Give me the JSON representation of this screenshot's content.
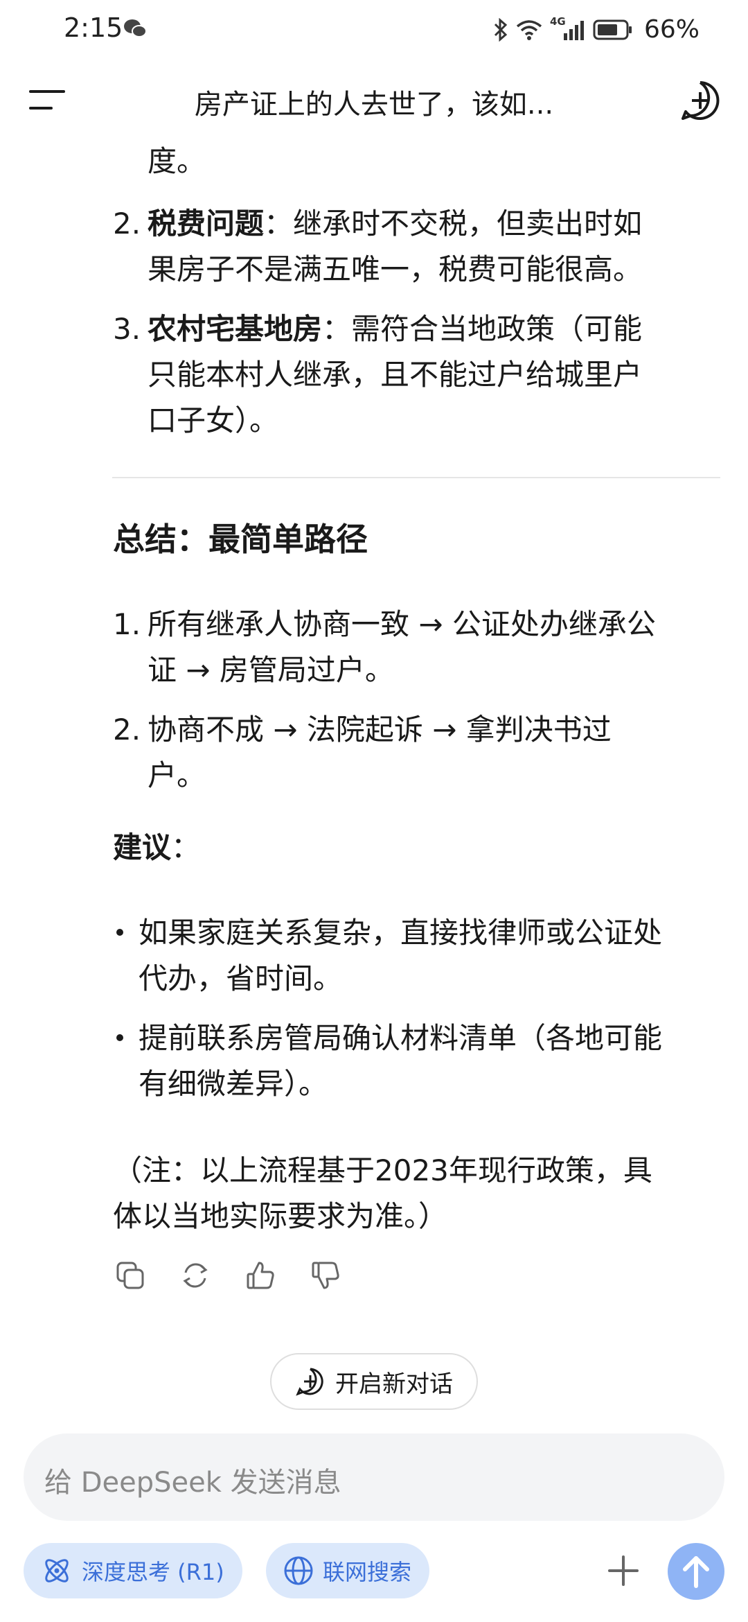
{
  "status_bar": {
    "time": "2:15",
    "network": "4G",
    "battery": "66%"
  },
  "header": {
    "title": "房产证上的人去世了，该如..."
  },
  "content": {
    "item1_tail": "度。",
    "item2_num": "2.",
    "item2_bold": "税费问题",
    "item2_line1": "：继承时不交税，但卖出时如",
    "item2_line2": "果房子不是满五唯一，税费可能很高。",
    "item3_num": "3.",
    "item3_bold": "农村宅基地房",
    "item3_line1": "：需符合当地政策（可能",
    "item3_line2": "只能本村人继承，且不能过户给城里户",
    "item3_line3": "口子女）。",
    "summary_heading": "总结：最简单路径",
    "path1_num": "1.",
    "path1_line1": "所有继承人协商一致 → 公证处办继承公",
    "path1_line2": "证 → 房管局过户。",
    "path2_num": "2.",
    "path2_line1": "协商不成 → 法院起诉 → 拿判决书过",
    "path2_line2": "户。",
    "advice_label": "建议",
    "advice_colon": "：",
    "advice1_line1": "如果家庭关系复杂，直接找律师或公证处",
    "advice1_line2": "代办，省时间。",
    "advice2_line1": "提前联系房管局确认材料清单（各地可能",
    "advice2_line2": "有细微差异）。",
    "note_line1": "（注：以上流程基于2023年现行政策，具",
    "note_line2": "体以当地实际要求为准。）"
  },
  "actions": {
    "icons": [
      "copy-icon",
      "regenerate-icon",
      "thumbs-up-icon",
      "thumbs-down-icon"
    ]
  },
  "new_chat": {
    "label": "开启新对话"
  },
  "composer": {
    "placeholder": "给 DeepSeek 发送消息",
    "deep_think_label": "深度思考 (R1)",
    "web_search_label": "联网搜索"
  },
  "colors": {
    "accent": "#3b6fd8",
    "pill_bg": "#dbe8fb",
    "send_bg": "#8fb4f5"
  }
}
